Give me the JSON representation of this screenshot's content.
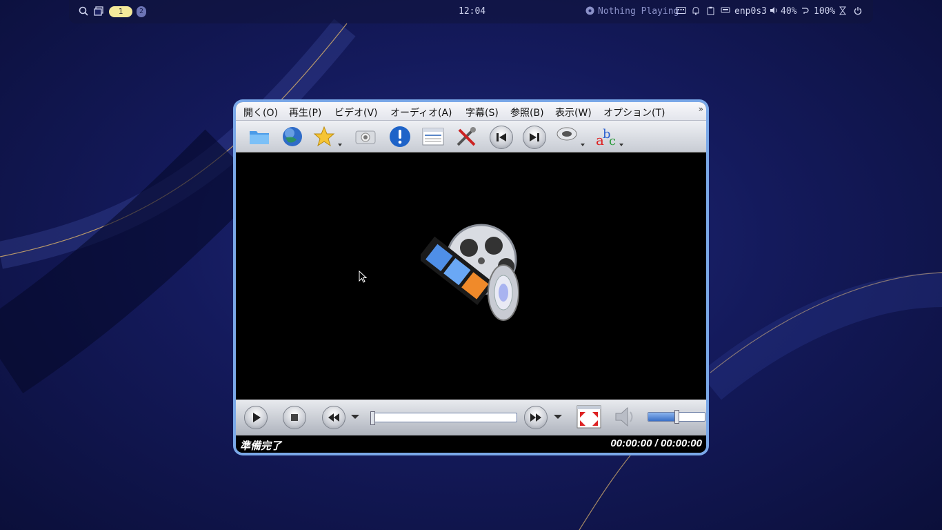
{
  "panel": {
    "workspace_active": "1",
    "workspace_other": "2",
    "clock": "12:04",
    "media": "Nothing Playing",
    "network": "enp0s3",
    "volume": "40%",
    "battery": "100%"
  },
  "player": {
    "menu": [
      "開く(O)",
      "再生(P)",
      "ビデオ(V)",
      "オーディオ(A)",
      "字幕(S)",
      "参照(B)",
      "表示(W)",
      "オプション(T)"
    ],
    "menu_overflow": "»",
    "toolbar_icons": [
      "open-folder-icon",
      "url-globe-icon",
      "favorites-star-icon",
      "screenshot-camera-icon",
      "info-icon",
      "playlist-icon",
      "preferences-tools-icon",
      "previous-icon",
      "next-icon",
      "audio-track-icon",
      "subtitles-icon"
    ],
    "status": "準備完了",
    "time": "00:00:00 / 00:00:00",
    "volume_level": 0.5,
    "seek_progress": 0.0
  },
  "colors": {
    "window_border": "#7aa8e8",
    "panel_workspace_active": "#f3e99a"
  }
}
